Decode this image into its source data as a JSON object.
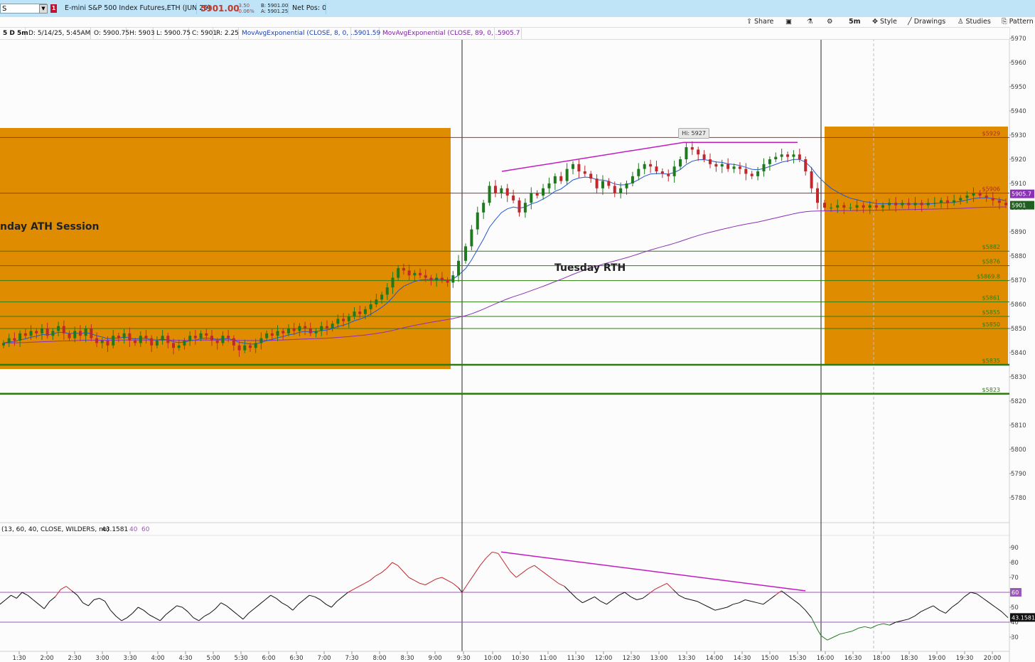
{
  "header": {
    "symbol_value": "S",
    "alert_badge": "1",
    "description": "E-mini S&P 500 Index Futures,ETH (JUN 25)",
    "last_price": "5901.00",
    "net_change": "-3.50",
    "pct_change": "-0.06%",
    "bid": "B: 5901.00",
    "ask": "A: 5901.25",
    "net_pos": "Net Pos: 0"
  },
  "toolbar": {
    "share": "Share",
    "timeframe": "5m",
    "style": "Style",
    "drawings": "Drawings",
    "studies": "Studies",
    "pattern": "Pattern"
  },
  "infobar": {
    "period": "5 D 5m",
    "date": "D: 5/14/25, 5:45AM",
    "open": "O: 5900.75",
    "high": "H: 5903",
    "low": "L: 5900.75",
    "close": "C: 5901",
    "range": "R: 2.25",
    "ema1_label": "MovAvgExponential (CLOSE, 8, 0, ...",
    "ema1_value": "5901.59",
    "ema2_label": "MovAvgExponential (CLOSE, 89, 0, ...",
    "ema2_value": "5905.7"
  },
  "lower_panel": {
    "study_label": "(13, 60, 40, CLOSE, WILDERS, no)",
    "study_value": "43.1581",
    "level_low": "40",
    "level_high": "60"
  },
  "annotations": {
    "monday": "nday ATH Session",
    "tuesday": "Tuesday RTH",
    "hi_label": "Hi: 5927"
  },
  "colors": {
    "zone": "#e08c00",
    "support": "#2e7d12",
    "resistance": "#b02a2a",
    "ema_fast": "#2257d6",
    "ema_slow": "#8b2fb8",
    "trendline": "#c21bc2",
    "candle_up": "#1f7a1f",
    "candle_down": "#c0282d"
  },
  "chart_data": [
    {
      "type": "candlestick",
      "title": "E-mini S&P 500 Index Futures,ETH (JUN 25)",
      "ylim": [
        5770,
        5972
      ],
      "y_ticks": [
        5780,
        5790,
        5800,
        5810,
        5820,
        5830,
        5840,
        5850,
        5860,
        5870,
        5880,
        5890,
        5900,
        5910,
        5920,
        5930,
        5940,
        5950,
        5960,
        5970
      ],
      "price_levels": [
        {
          "label": "5929",
          "value": 5929,
          "kind": "resistance"
        },
        {
          "label": "5906",
          "value": 5906,
          "kind": "resistance"
        },
        {
          "label": "5882",
          "value": 5882,
          "kind": "support"
        },
        {
          "label": "5876",
          "value": 5876,
          "kind": "support"
        },
        {
          "label": "5869.8",
          "value": 5869.8,
          "kind": "support"
        },
        {
          "label": "5861",
          "value": 5861,
          "kind": "support"
        },
        {
          "label": "5855",
          "value": 5855,
          "kind": "support"
        },
        {
          "label": "5850",
          "value": 5850,
          "kind": "support"
        },
        {
          "label": "5835",
          "value": 5835,
          "kind": "support"
        },
        {
          "label": "5823",
          "value": 5823,
          "kind": "support"
        }
      ],
      "last_price_tag": "5901",
      "ema_tag": "5905.7",
      "series": [
        {
          "name": "MovAvgExponential (CLOSE, 8, 0, ...",
          "kind": "ema_fast"
        },
        {
          "name": "MovAvgExponential (CLOSE, 89, 0, ...",
          "kind": "ema_slow"
        }
      ],
      "closes": [
        5844,
        5846,
        5845,
        5848,
        5847,
        5849,
        5848,
        5850,
        5847,
        5849,
        5851,
        5848,
        5846,
        5849,
        5847,
        5850,
        5846,
        5844,
        5845,
        5843,
        5847,
        5846,
        5848,
        5845,
        5844,
        5847,
        5846,
        5843,
        5845,
        5847,
        5844,
        5842,
        5843,
        5845,
        5847,
        5846,
        5848,
        5847,
        5845,
        5844,
        5847,
        5846,
        5843,
        5841,
        5843,
        5842,
        5844,
        5846,
        5848,
        5847,
        5849,
        5848,
        5850,
        5849,
        5851,
        5850,
        5848,
        5849,
        5851,
        5850,
        5852,
        5854,
        5853,
        5855,
        5857,
        5856,
        5858,
        5860,
        5862,
        5864,
        5867,
        5871,
        5875,
        5874,
        5872,
        5873,
        5872,
        5871,
        5870,
        5871,
        5870,
        5869,
        5872,
        5878,
        5884,
        5891,
        5898,
        5902,
        5909,
        5906,
        5908,
        5905,
        5903,
        5898,
        5902,
        5906,
        5905,
        5908,
        5910,
        5913,
        5911,
        5916,
        5918,
        5915,
        5914,
        5912,
        5908,
        5911,
        5909,
        5906,
        5908,
        5910,
        5913,
        5916,
        5918,
        5917,
        5915,
        5914,
        5913,
        5917,
        5920,
        5925,
        5924,
        5922,
        5920,
        5918,
        5917,
        5918,
        5916,
        5917,
        5916,
        5914,
        5913,
        5915,
        5918,
        5920,
        5921,
        5922,
        5921,
        5922,
        5920,
        5915,
        5908,
        5902,
        5900,
        5900,
        5901,
        5900,
        5900,
        5901,
        5900,
        5901,
        5900,
        5901,
        5902,
        5901,
        5902,
        5901,
        5902,
        5901,
        5902,
        5902,
        5903,
        5902,
        5903,
        5904,
        5905,
        5906,
        5905,
        5904,
        5903,
        5902,
        5901
      ],
      "trendline": {
        "from": 5915,
        "to": 5927
      }
    },
    {
      "type": "line",
      "title": "(13, 60, 40, CLOSE, WILDERS, no)",
      "ylim": [
        24,
        95
      ],
      "y_ticks": [
        30,
        40,
        50,
        60,
        70,
        80,
        90
      ],
      "levels": [
        60,
        40
      ],
      "last_value": "43.1581",
      "x_ticks": [
        "1:30",
        "2:00",
        "2:30",
        "3:00",
        "3:30",
        "4:00",
        "4:30",
        "5:00",
        "5:30",
        "6:00",
        "6:30",
        "7:00",
        "7:30",
        "8:00",
        "8:30",
        "9:00",
        "9:30",
        "10:00",
        "10:30",
        "11:00",
        "11:30",
        "12:00",
        "12:30",
        "13:00",
        "13:30",
        "14:00",
        "14:30",
        "15:00",
        "15:30",
        "16:00",
        "16:30",
        "18:00",
        "18:30",
        "19:00",
        "19:30",
        "20:00"
      ],
      "values": [
        52,
        55,
        58,
        56,
        60,
        58,
        55,
        52,
        49,
        54,
        57,
        62,
        64,
        61,
        58,
        53,
        51,
        55,
        56,
        54,
        48,
        44,
        41,
        43,
        46,
        50,
        48,
        45,
        43,
        41,
        45,
        48,
        51,
        50,
        47,
        43,
        41,
        44,
        46,
        49,
        53,
        51,
        48,
        45,
        42,
        46,
        49,
        52,
        55,
        58,
        56,
        53,
        51,
        48,
        52,
        55,
        58,
        57,
        55,
        52,
        50,
        54,
        57,
        60,
        62,
        64,
        66,
        68,
        71,
        73,
        76,
        80,
        78,
        74,
        70,
        68,
        66,
        65,
        67,
        69,
        70,
        68,
        66,
        63,
        60,
        66,
        72,
        78,
        83,
        87,
        86,
        80,
        74,
        70,
        73,
        76,
        78,
        75,
        72,
        69,
        66,
        64,
        60,
        56,
        53,
        55,
        57,
        54,
        52,
        55,
        58,
        60,
        57,
        55,
        56,
        59,
        62,
        64,
        66,
        62,
        58,
        56,
        55,
        54,
        52,
        50,
        48,
        49,
        50,
        52,
        53,
        55,
        54,
        53,
        52,
        55,
        58,
        61,
        58,
        55,
        52,
        48,
        43,
        35,
        31,
        28,
        30,
        32,
        33,
        34,
        36,
        37,
        36,
        38,
        39,
        38,
        40,
        41,
        42,
        44,
        47,
        49,
        51,
        48,
        46,
        50,
        53,
        57,
        60,
        59,
        56,
        53,
        50,
        47,
        43
      ]
    }
  ]
}
